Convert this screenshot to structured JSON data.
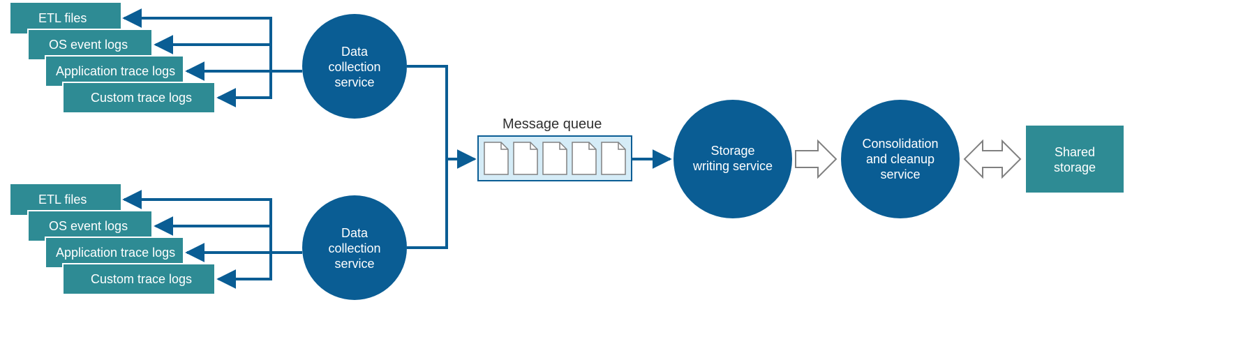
{
  "colors": {
    "teal": "#2e8b94",
    "blue": "#0a5d94",
    "lightBlue": "#d5ecf7",
    "outline": "#808080",
    "docStroke": "#808080",
    "white": "#ffffff"
  },
  "sources": {
    "items": [
      {
        "label": "ETL files"
      },
      {
        "label": "OS event logs"
      },
      {
        "label": "Application trace logs"
      },
      {
        "label": "Custom trace logs"
      }
    ]
  },
  "collector": {
    "line1": "Data",
    "line2": "collection",
    "line3": "service"
  },
  "queue": {
    "title": "Message queue"
  },
  "storageWriter": {
    "line1": "Storage",
    "line2": "writing service"
  },
  "consolidation": {
    "line1": "Consolidation",
    "line2": "and cleanup",
    "line3": "service"
  },
  "sharedStorage": {
    "line1": "Shared",
    "line2": "storage"
  }
}
